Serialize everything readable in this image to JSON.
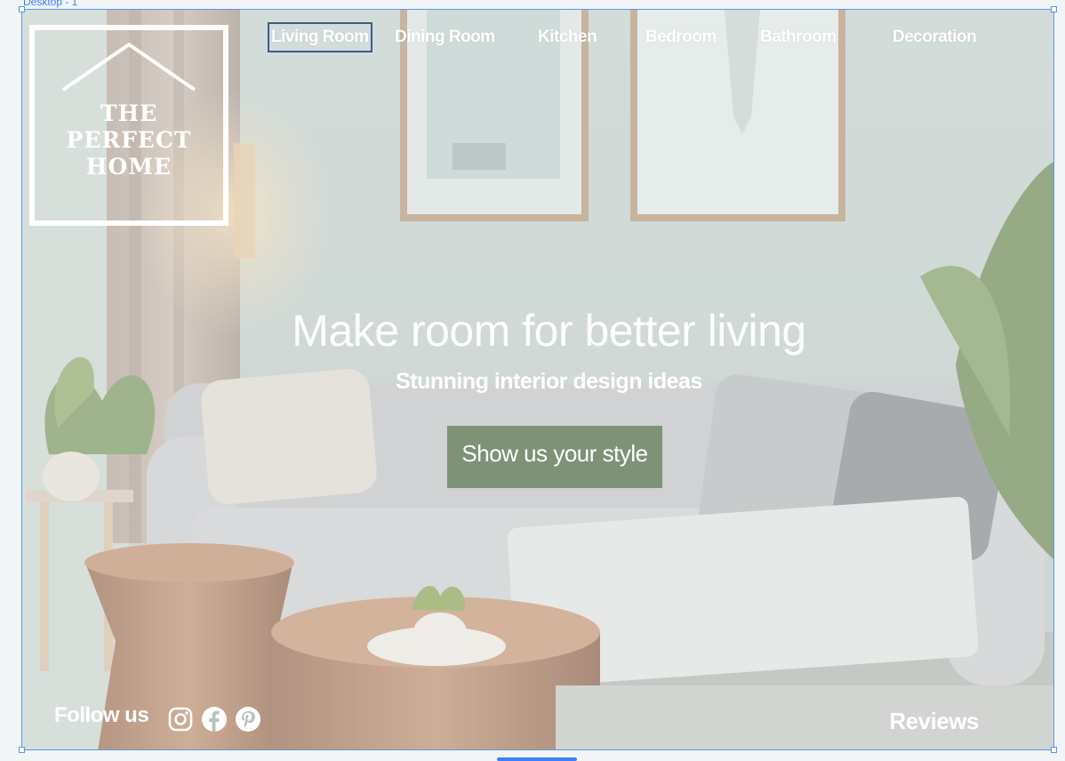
{
  "canvas": {
    "frame_label": "Desktop - 1"
  },
  "logo": {
    "line1": "THE",
    "line2": "PERFECT",
    "line3": "HOME"
  },
  "nav": {
    "items": [
      {
        "label": "Living Room"
      },
      {
        "label": "Dining Room"
      },
      {
        "label": "Kitchen"
      },
      {
        "label": "Bedroom"
      },
      {
        "label": "Bathroom"
      },
      {
        "label": "Decoration"
      }
    ],
    "active_index": 0
  },
  "hero": {
    "title": "Make room for better living",
    "subtitle": "Stunning interior design ideas",
    "cta_label": "Show us your style"
  },
  "footer": {
    "follow_label": "Follow us",
    "social_icons": [
      "instagram-icon",
      "facebook-icon",
      "pinterest-icon"
    ],
    "reviews_label": "Reviews"
  },
  "colors": {
    "cta_bg": "#7d9277",
    "selection": "#4f9cf0",
    "active_border": "#3d5a8a",
    "text": "#ffffff"
  }
}
